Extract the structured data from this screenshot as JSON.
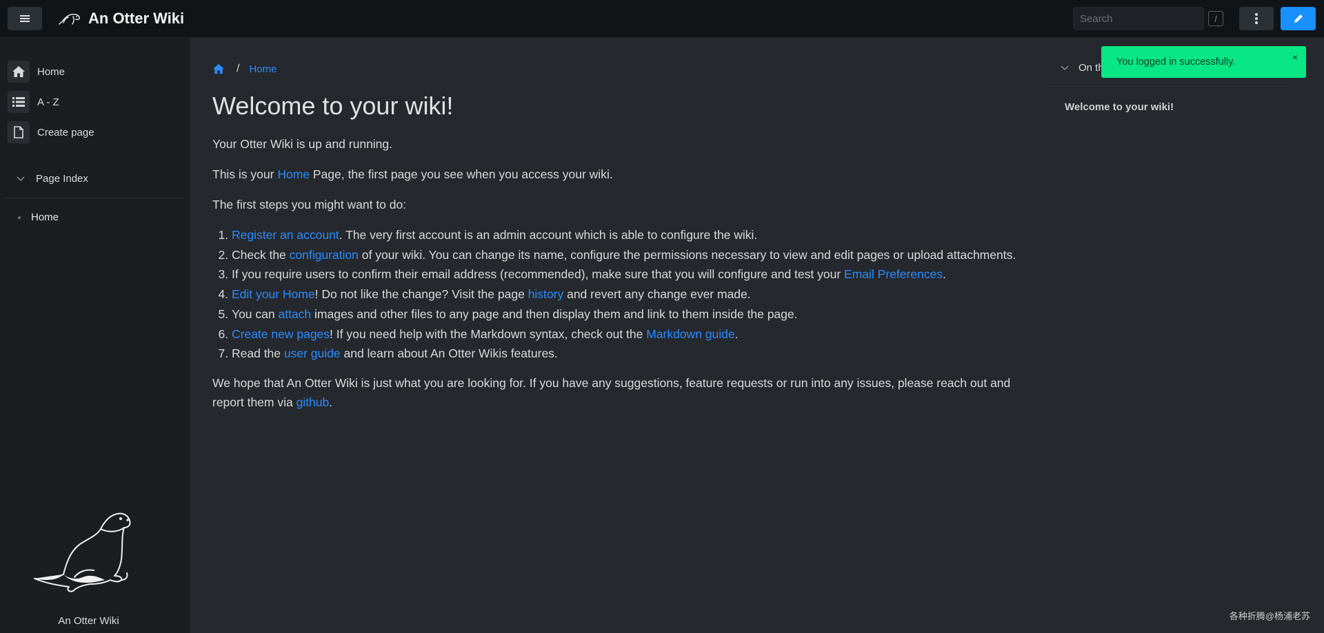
{
  "navbar": {
    "title": "An Otter Wiki",
    "search_placeholder": "Search",
    "search_shortcut": "/",
    "icons": [
      "menu-icon",
      "otter-logo",
      "more-vertical-icon",
      "pencil-icon"
    ]
  },
  "sidebar": {
    "items": [
      {
        "label": "Home",
        "icon": "home-icon"
      },
      {
        "label": "A - Z",
        "icon": "list-icon"
      },
      {
        "label": "Create page",
        "icon": "file-icon"
      }
    ],
    "page_index": {
      "label": "Page Index",
      "items": [
        "Home"
      ]
    },
    "footer": "An Otter Wiki"
  },
  "breadcrumb": {
    "separator": "/",
    "current": "Home"
  },
  "content": {
    "title": "Welcome to your wiki!",
    "p1": "Your Otter Wiki is up and running.",
    "p2": {
      "a": "This is your ",
      "link": "Home",
      "b": " Page, the first page you see when you access your wiki."
    },
    "p3": "The first steps you might want to do:",
    "steps": [
      {
        "link": "Register an account",
        "b": ". The very first account is an admin account which is able to configure the wiki."
      },
      {
        "a": "Check the ",
        "link": "configuration",
        "b": " of your wiki. You can change its name, configure the permissions necessary to view and edit pages or upload attachments."
      },
      {
        "a": "If you require users to confirm their email address (recommended), make sure that you will configure and test your ",
        "link": "Email Preferences",
        "b": "."
      },
      {
        "link": "Edit your Home",
        "b": "! Do not like the change? Visit the page ",
        "link2": "history",
        "c": " and revert any change ever made."
      },
      {
        "a": "You can ",
        "link": "attach",
        "b": " images and other files to any page and then display them and link to them inside the page."
      },
      {
        "link": "Create new pages",
        "b": "! If you need help with the Markdown syntax, check out the ",
        "link2": "Markdown guide",
        "c": "."
      },
      {
        "a": "Read the ",
        "link": "user guide",
        "b": " and learn about An Otter Wikis features."
      }
    ],
    "p4": {
      "a": "We hope that An Otter Wiki is just what you are looking for. If you have any suggestions, feature requests or run into any issues, please reach out and report them via ",
      "link": "github",
      "b": "."
    }
  },
  "toc": {
    "label": "On this page",
    "items": [
      "Welcome to your wiki!"
    ]
  },
  "toast": {
    "message": "You logged in successfully.",
    "close": "×",
    "color": "#08e783"
  },
  "watermark": "各种折腾@杨浦老苏",
  "colors": {
    "link": "#2b8cff",
    "primary_button": "#1890ff",
    "navbar_bg": "#111417",
    "sidebar_bg": "#1b1e21",
    "content_bg": "#25282c"
  }
}
